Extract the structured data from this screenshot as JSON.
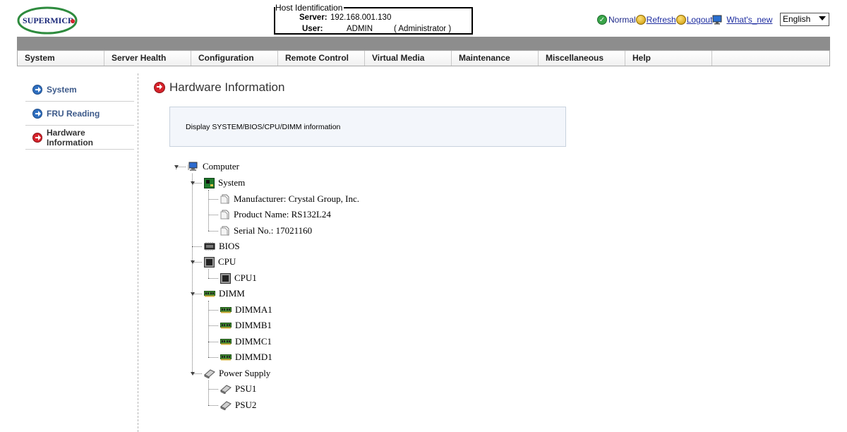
{
  "header": {
    "logo_text": "SUPERMICR",
    "host": {
      "legend": "Host Identification",
      "server_label": "Server:",
      "server_value": "192.168.001.130",
      "user_label": "User:",
      "user_value": "ADMIN",
      "user_role": "( Administrator )"
    },
    "status_text": "Normal",
    "refresh_label": "Refresh",
    "logout_label": "Logout",
    "whats_new_label": "What's_new",
    "language": "English"
  },
  "menu": [
    "System",
    "Server Health",
    "Configuration",
    "Remote Control",
    "Virtual Media",
    "Maintenance",
    "Miscellaneous",
    "Help"
  ],
  "sidebar": {
    "items": [
      {
        "label": "System",
        "active": false
      },
      {
        "label": "FRU Reading",
        "active": false
      },
      {
        "label": "Hardware Information",
        "active": true
      }
    ]
  },
  "main": {
    "title": "Hardware Information",
    "description": "Display SYSTEM/BIOS/CPU/DIMM information"
  },
  "tree": {
    "root": "Computer",
    "system": "System",
    "manufacturer": "Manufacturer: Crystal Group, Inc.",
    "product_name": "Product Name: RS132L24",
    "serial_no": "Serial No.: 17021160",
    "bios": "BIOS",
    "cpu": "CPU",
    "cpu1": "CPU1",
    "dimm": "DIMM",
    "dimma1": "DIMMA1",
    "dimmb1": "DIMMB1",
    "dimmc1": "DIMMC1",
    "dimmd1": "DIMMD1",
    "power_supply": "Power Supply",
    "psu1": "PSU1",
    "psu2": "PSU2"
  },
  "icons": {
    "computer": "computer-icon",
    "board": "motherboard-icon",
    "doc": "document-icon",
    "chip": "chip-icon",
    "memory": "memory-module-icon",
    "psu": "power-supply-icon"
  },
  "colors": {
    "menu_gray": "#8d8d8d",
    "link_blue": "#1e2da0",
    "active_red": "#d6232b",
    "nav_blue": "#2f6fc0"
  }
}
